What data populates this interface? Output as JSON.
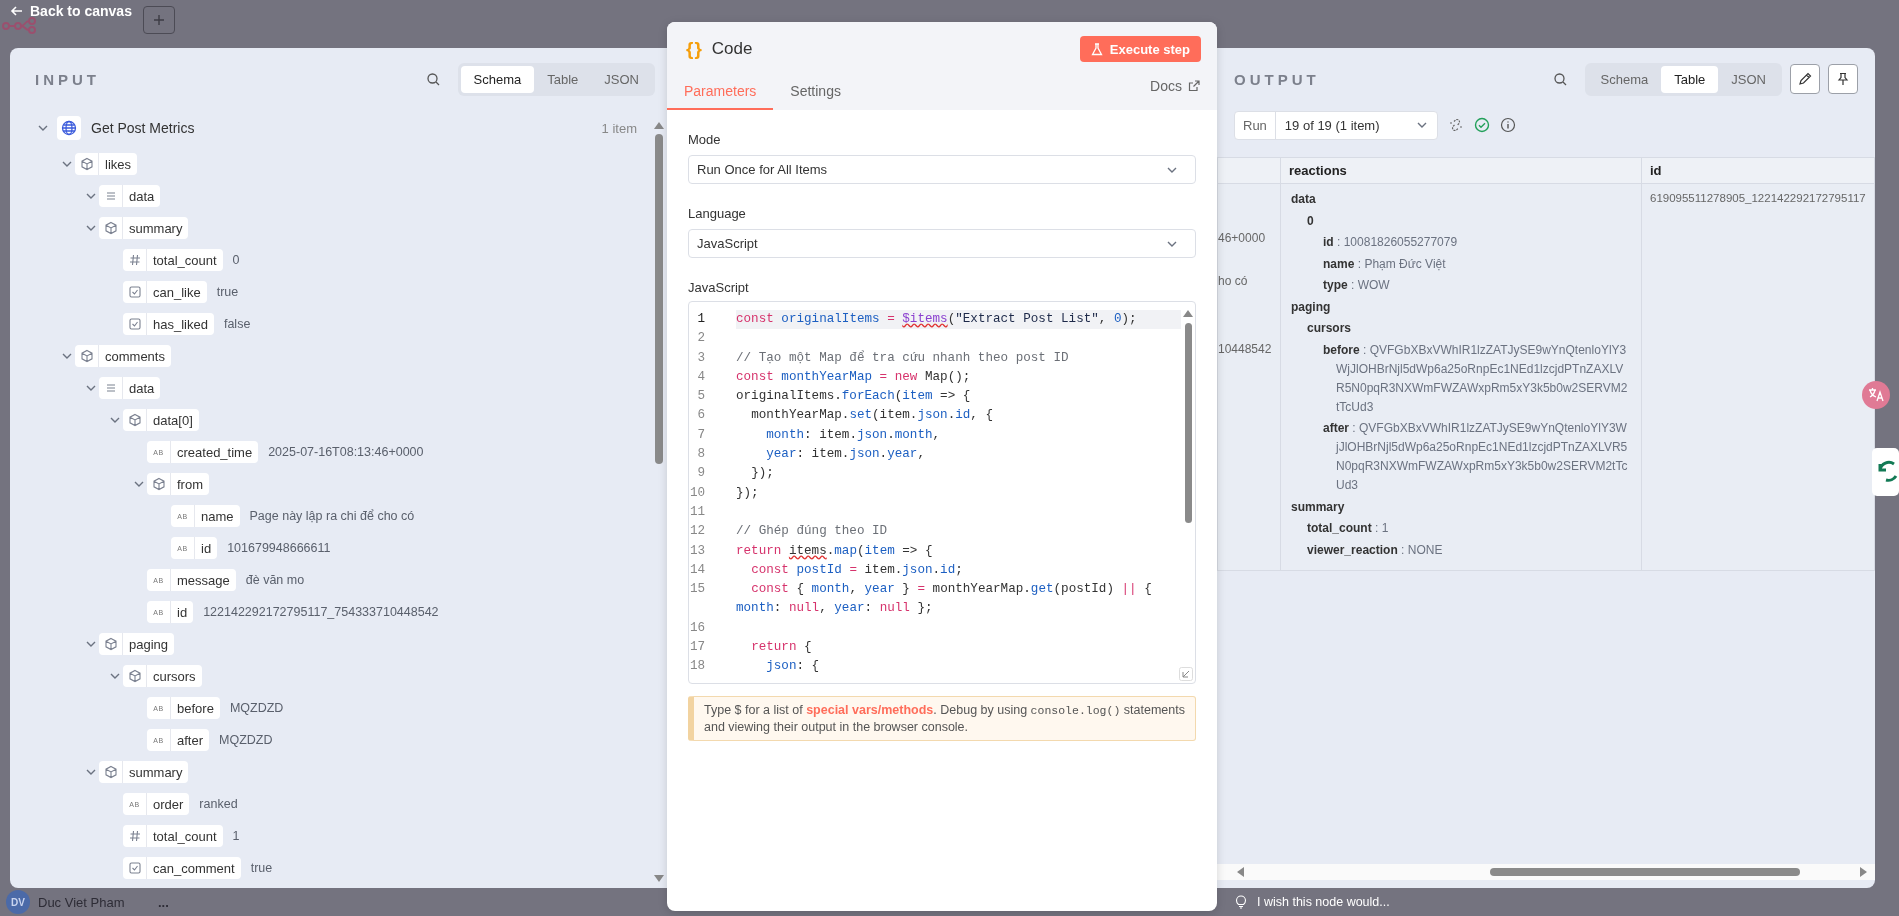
{
  "header": {
    "back_label": "Back to canvas"
  },
  "input": {
    "title": "INPUT",
    "tabs": [
      {
        "label": "Schema",
        "selected": true
      },
      {
        "label": "Table",
        "selected": false
      },
      {
        "label": "JSON",
        "selected": false
      }
    ],
    "tree": {
      "label": "Get Post Metrics",
      "count": "1 item",
      "expanded": true,
      "children": [
        {
          "kind": "object",
          "key": "likes",
          "expanded": true,
          "children": [
            {
              "kind": "array",
              "key": "data",
              "expanded": true
            },
            {
              "kind": "object",
              "key": "summary",
              "expanded": true,
              "children": [
                {
                  "kind": "number",
                  "key": "total_count",
                  "value": "0"
                },
                {
                  "kind": "boolean",
                  "key": "can_like",
                  "value": "true"
                },
                {
                  "kind": "boolean",
                  "key": "has_liked",
                  "value": "false"
                }
              ]
            }
          ]
        },
        {
          "kind": "object",
          "key": "comments",
          "expanded": true,
          "children": [
            {
              "kind": "array",
              "key": "data",
              "expanded": true,
              "children": [
                {
                  "kind": "object",
                  "key": "data[0]",
                  "expanded": true,
                  "children": [
                    {
                      "kind": "string",
                      "badge": "AB",
                      "key": "created_time",
                      "value": "2025-07-16T08:13:46+0000"
                    },
                    {
                      "kind": "object",
                      "key": "from",
                      "expanded": true,
                      "children": [
                        {
                          "kind": "string",
                          "badge": "AB",
                          "key": "name",
                          "value": "Page này lập ra chi để cho có"
                        },
                        {
                          "kind": "string",
                          "badge": "AB",
                          "key": "id",
                          "value": "101679948666611"
                        }
                      ]
                    },
                    {
                      "kind": "string",
                      "badge": "AB",
                      "key": "message",
                      "value": "đè văn mo"
                    },
                    {
                      "kind": "string",
                      "badge": "AB",
                      "key": "id",
                      "value": "122142292172795117_754333710448542"
                    }
                  ]
                }
              ]
            },
            {
              "kind": "object",
              "key": "paging",
              "expanded": true,
              "children": [
                {
                  "kind": "object",
                  "key": "cursors",
                  "expanded": true,
                  "children": [
                    {
                      "kind": "string",
                      "badge": "AB",
                      "key": "before",
                      "value": "MQZDZD"
                    },
                    {
                      "kind": "string",
                      "badge": "AB",
                      "key": "after",
                      "value": "MQZDZD"
                    }
                  ]
                }
              ]
            },
            {
              "kind": "object",
              "key": "summary",
              "expanded": true,
              "children": [
                {
                  "kind": "string",
                  "badge": "AB",
                  "key": "order",
                  "value": "ranked"
                },
                {
                  "kind": "number",
                  "key": "total_count",
                  "value": "1"
                },
                {
                  "kind": "boolean",
                  "key": "can_comment",
                  "value": "true"
                }
              ]
            }
          ]
        }
      ]
    }
  },
  "code_panel": {
    "icon": "{}",
    "title": "Code",
    "execute_label": "Execute step",
    "tabs": [
      {
        "label": "Parameters",
        "selected": true
      },
      {
        "label": "Settings",
        "selected": false
      }
    ],
    "docs_label": "Docs",
    "mode": {
      "label": "Mode",
      "value": "Run Once for All Items"
    },
    "language": {
      "label": "Language",
      "value": "JavaScript"
    },
    "editor": {
      "label": "JavaScript",
      "lines": [
        {
          "number": "1",
          "active": true,
          "tokens": [
            {
              "kind": "keyword",
              "text": "const "
            },
            {
              "kind": "name",
              "text": "originalItems "
            },
            {
              "kind": "operator",
              "text": "= "
            },
            {
              "kind": "special",
              "text": "$items"
            },
            {
              "kind": "plain",
              "text": "("
            },
            {
              "kind": "string",
              "text": "\"Extract Post List\""
            },
            {
              "kind": "plain",
              "text": ", "
            },
            {
              "kind": "number",
              "text": "0"
            },
            {
              "kind": "plain",
              "text": ");"
            }
          ]
        },
        {
          "number": "2",
          "active": false
        },
        {
          "number": "3",
          "active": false,
          "tokens": [
            {
              "kind": "comment",
              "text": "// Tạo một Map để tra cứu nhanh theo post ID"
            }
          ]
        },
        {
          "number": "4",
          "active": false,
          "tokens": [
            {
              "kind": "keyword",
              "text": "const"
            },
            {
              "kind": "name",
              "text": " monthYearMap"
            },
            {
              "kind": "operator",
              "text": " ="
            },
            {
              "kind": "keyword",
              "text": " new"
            },
            {
              "kind": "plain",
              "text": " Map();"
            }
          ]
        },
        {
          "number": "5",
          "active": false,
          "tokens": [
            {
              "kind": "plain",
              "text": "originalItems."
            },
            {
              "kind": "name",
              "text": "forEach"
            },
            {
              "kind": "plain",
              "text": "("
            },
            {
              "kind": "name",
              "text": "item"
            },
            {
              "kind": "plain",
              "text": " => {"
            }
          ]
        },
        {
          "number": "6",
          "active": false,
          "tokens": [
            {
              "kind": "plain",
              "text": "  monthYearMap."
            },
            {
              "kind": "name",
              "text": "set"
            },
            {
              "kind": "plain",
              "text": "(item."
            },
            {
              "kind": "name",
              "text": "json"
            },
            {
              "kind": "plain",
              "text": "."
            },
            {
              "kind": "name",
              "text": "id"
            },
            {
              "kind": "plain",
              "text": ", {"
            }
          ]
        },
        {
          "number": "7",
          "active": false,
          "tokens": [
            {
              "kind": "name",
              "text": "    month"
            },
            {
              "kind": "plain",
              "text": ": item."
            },
            {
              "kind": "name",
              "text": "json"
            },
            {
              "kind": "plain",
              "text": "."
            },
            {
              "kind": "name",
              "text": "month"
            },
            {
              "kind": "plain",
              "text": ","
            }
          ]
        },
        {
          "number": "8",
          "active": false,
          "tokens": [
            {
              "kind": "name",
              "text": "    year"
            },
            {
              "kind": "plain",
              "text": ": item."
            },
            {
              "kind": "name",
              "text": "json"
            },
            {
              "kind": "plain",
              "text": "."
            },
            {
              "kind": "name",
              "text": "year"
            },
            {
              "kind": "plain",
              "text": ","
            }
          ]
        },
        {
          "number": "9",
          "active": false,
          "tokens": [
            {
              "kind": "plain",
              "text": "  });"
            }
          ]
        },
        {
          "number": "10",
          "active": false,
          "tokens": [
            {
              "kind": "plain",
              "text": "});"
            }
          ]
        },
        {
          "number": "11",
          "active": false
        },
        {
          "number": "12",
          "active": false,
          "tokens": [
            {
              "kind": "comment",
              "text": "// Ghép đúng theo ID"
            }
          ]
        },
        {
          "number": "13",
          "active": false,
          "tokens": [
            {
              "kind": "keyword",
              "text": "return "
            },
            {
              "kind": "flagged",
              "text": "items"
            },
            {
              "kind": "plain",
              "text": "."
            },
            {
              "kind": "name",
              "text": "map"
            },
            {
              "kind": "plain",
              "text": "("
            },
            {
              "kind": "name",
              "text": "item"
            },
            {
              "kind": "plain",
              "text": " => {"
            }
          ]
        },
        {
          "number": "14",
          "active": false,
          "tokens": [
            {
              "kind": "keyword",
              "text": "  const"
            },
            {
              "kind": "name",
              "text": " postId"
            },
            {
              "kind": "operator",
              "text": " ="
            },
            {
              "kind": "plain",
              "text": " item."
            },
            {
              "kind": "name",
              "text": "json"
            },
            {
              "kind": "plain",
              "text": "."
            },
            {
              "kind": "name",
              "text": "id"
            },
            {
              "kind": "plain",
              "text": ";"
            }
          ]
        },
        {
          "number": "15",
          "active": false,
          "tokens": [
            {
              "kind": "keyword",
              "text": "  const"
            },
            {
              "kind": "plain",
              "text": " { "
            },
            {
              "kind": "name",
              "text": "month"
            },
            {
              "kind": "plain",
              "text": ", "
            },
            {
              "kind": "name",
              "text": "year"
            },
            {
              "kind": "plain",
              "text": " } "
            },
            {
              "kind": "operator",
              "text": "="
            },
            {
              "kind": "plain",
              "text": " monthYearMap."
            },
            {
              "kind": "name",
              "text": "get"
            },
            {
              "kind": "plain",
              "text": "(postId) "
            },
            {
              "kind": "operator",
              "text": "||"
            },
            {
              "kind": "plain",
              "text": " { "
            },
            {
              "kind": "name",
              "text": "month"
            },
            {
              "kind": "plain",
              "text": ": "
            },
            {
              "kind": "keyword",
              "text": "null"
            },
            {
              "kind": "plain",
              "text": ", "
            },
            {
              "kind": "name",
              "text": "year"
            },
            {
              "kind": "plain",
              "text": ": "
            },
            {
              "kind": "keyword",
              "text": "null"
            },
            {
              "kind": "plain",
              "text": " };"
            }
          ]
        },
        {
          "number": "16",
          "active": false
        },
        {
          "number": "17",
          "active": false,
          "tokens": [
            {
              "kind": "keyword",
              "text": "  return"
            },
            {
              "kind": "plain",
              "text": " {"
            }
          ]
        },
        {
          "number": "18",
          "active": false,
          "tokens": [
            {
              "kind": "name",
              "text": "    json"
            },
            {
              "kind": "plain",
              "text": ": {"
            }
          ]
        }
      ]
    },
    "hint": [
      {
        "kind": "text",
        "text": "Type $ for a list of "
      },
      {
        "kind": "link",
        "text": "special vars/methods"
      },
      {
        "kind": "text",
        "text": ". Debug by using "
      },
      {
        "kind": "code",
        "text": "console.log()"
      },
      {
        "kind": "text",
        "text": " statements and viewing their output in the browser console."
      }
    ]
  },
  "output": {
    "title": "OUTPUT",
    "tabs": [
      {
        "label": "Schema",
        "selected": false
      },
      {
        "label": "Table",
        "selected": true
      },
      {
        "label": "JSON",
        "selected": false
      }
    ],
    "run": {
      "label": "Run",
      "value": "19 of 19 (1 item)"
    },
    "table": {
      "columns": [
        "reactions",
        "id"
      ],
      "separator": ":",
      "rows": [
        {
          "column_1": [
            "46+0000",
            "ho có",
            "10448542"
          ],
          "reactions": [
            {
              "key": "data",
              "children": [
                {
                  "key": "0",
                  "children": [
                    {
                      "key": "id",
                      "value": "10081826055277079"
                    },
                    {
                      "key": "name",
                      "value": "Phạm Đức Việt"
                    },
                    {
                      "key": "type",
                      "value": "WOW"
                    }
                  ]
                }
              ]
            },
            {
              "key": "paging",
              "children": [
                {
                  "key": "cursors",
                  "children": [
                    {
                      "key": "before",
                      "value": "QVFGbXBxVWhIR1lzZATJySE9wYnQtenloYlY3WjJlOHBrNjl5dWp6a25oRnpEc1NEd1lzcjdPTnZAXLVR5N0pqR3NXWmFWZAWxpRm5xY3k5b0w2SERVM2tTcUd3"
                    },
                    {
                      "key": "after",
                      "value": "QVFGbXBxVWhIR1lzZATJySE9wYnQtenloYlY3WjJlOHBrNjl5dWp6a25oRnpEc1NEd1lzcjdPTnZAXLVR5N0pqR3NXWmFWZAWxpRm5xY3k5b0w2SERVM2tTcUd3"
                    }
                  ]
                }
              ]
            },
            {
              "key": "summary",
              "children": [
                {
                  "key": "total_count",
                  "value": "1"
                },
                {
                  "key": "viewer_reaction",
                  "value": "NONE"
                }
              ]
            }
          ],
          "id": "619095511278905_122142292172795117"
        }
      ]
    }
  },
  "footer": {
    "user_initials": "DV",
    "user_name": "Duc Viet Pham",
    "user_menu": "...",
    "feedback": "I wish this node would..."
  }
}
